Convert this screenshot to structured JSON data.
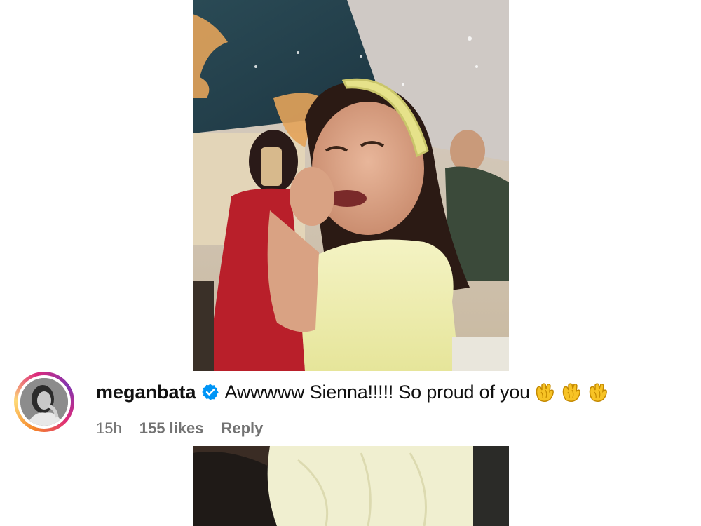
{
  "photo_top": {
    "alt": "photo-of-crying-girl"
  },
  "photo_bottom": {
    "alt": "photo-of-white-dress"
  },
  "comment": {
    "username": "meganbata",
    "verified_icon": "verified-badge-icon",
    "text": "Awwwww Sienna!!!!! So proud of you",
    "emojis": [
      "clapping-hands-icon",
      "clapping-hands-icon",
      "clapping-hands-icon"
    ],
    "time": "15h",
    "likes": "155 likes",
    "reply_label": "Reply"
  },
  "colors": {
    "verified": "#0095f6",
    "meta_text": "#737373",
    "ring": [
      "#f58529",
      "#dd2a7b",
      "#8134af"
    ]
  }
}
